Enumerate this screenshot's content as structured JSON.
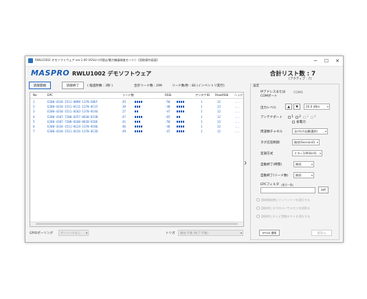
{
  "window": {
    "title": "RWLU1002 デモソフトウェア ver.1.00 VS%U (代理店/電力機器検査モード) - [読取操作画面]",
    "buttons": [
      "─",
      "☐",
      "✕"
    ]
  },
  "header": {
    "logo": "MASPRO",
    "app_title": "RWLU1002 デモソフトウェア",
    "total_list": "合計リスト数 : 7",
    "active": "[アクティブ : 7]"
  },
  "toolbar": {
    "start_label": "読取開始",
    "stop_label": "読取終了",
    "elapsed": "( 経過秒数 : 3秒 )",
    "total_reads": "合計リード数 : 299",
    "reads_per_sec": "リード数/秒 : 82 (インベントリ実行)"
  },
  "table": {
    "columns": [
      "No",
      "EPC",
      "リード数",
      "RSSI",
      "アンテナID",
      "PeakRSSI",
      "ヘッド"
    ],
    "rows": [
      {
        "no": "1",
        "epc": "E200-4334-1511-0098-1370-E0EF",
        "reads": "45",
        "rssi": "-50",
        "ant": "1",
        "peak": "12",
        "tail": "..."
      },
      {
        "no": "2",
        "epc": "E200-4334-1511-0111-1370-8C15",
        "reads": "39",
        "rssi": "-48",
        "ant": "1",
        "peak": "12",
        "tail": "..."
      },
      {
        "no": "3",
        "epc": "E200-4334-1511-0103-1370-8C46",
        "reads": "27",
        "rssi": "-47",
        "ant": "1",
        "peak": "12",
        "tail": "..."
      },
      {
        "no": "4",
        "epc": "E200-4107-7200-0257-0630-D23B",
        "reads": "47",
        "rssi": "-65",
        "ant": "1",
        "peak": "12",
        "tail": "..."
      },
      {
        "no": "5",
        "epc": "E200-4107-7200-0160-0620-D20E",
        "reads": "41",
        "rssi": "-50",
        "ant": "1",
        "peak": "12",
        "tail": "..."
      },
      {
        "no": "6",
        "epc": "E200-4334-1511-0124-1370-8C86",
        "reads": "46",
        "rssi": "-46",
        "ant": "1",
        "peak": "12",
        "tail": "..."
      },
      {
        "no": "7",
        "epc": "E200-4334-1511-0134-1370-8C3D",
        "reads": "49",
        "rssi": "-47",
        "ant": "1",
        "peak": "12",
        "tail": "..."
      }
    ]
  },
  "bottom": {
    "gpio_label": "GPIOポーリング",
    "gpio_value": "ポーリングなし",
    "trigger_label": "トリガ",
    "trigger_value": "開始:手動 (終了:手動)"
  },
  "settings": {
    "title": "設定",
    "ip_label1": "IPアドレスまたは",
    "ip_label2": "COMポート",
    "ip_value": "COM3",
    "power_label": "出力レベル",
    "power_value": "20.0 dBm",
    "antenna_label": "アンテナポート",
    "antenna_ports": [
      "1",
      "2",
      "3",
      "4"
    ],
    "power_save": "省電力",
    "channel_label": "周波数チャネル",
    "channel_value": "全ch(ch自動選択)",
    "tag_label": "タグ応答制御",
    "tag_value": "無効(Session0)",
    "modulation_label": "変調方式",
    "modulation_value": "ミラー1(Miller4)",
    "autostart_label": "自動終了(時間)",
    "autostart_value": "無効",
    "autostop_label": "自動終了(リード数)",
    "autostop_value": "無効",
    "epc_filter_label": "EPCフィルタ",
    "epc_filter_sub": "(前方一致)",
    "set_label": "set",
    "radio_options": [
      "読取開始時にインベントリを実行する",
      "読取時にタグのユーザメモリを読取る",
      "読取時にテレビ受動テストを実行する"
    ],
    "epc_write_label": "EPCID 書換",
    "apply_label": "適用(A)"
  }
}
